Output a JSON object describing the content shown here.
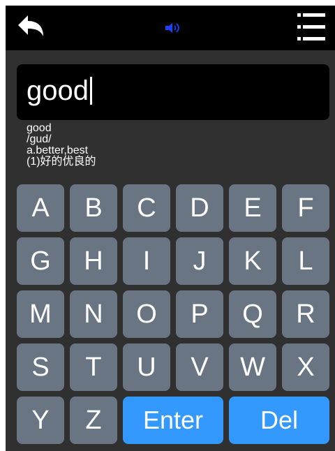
{
  "app": {
    "background": "#303030",
    "topbar_color": "#000000"
  },
  "toolbar": {
    "back_icon": "back-arrow-icon",
    "speaker_icon": "speaker-icon",
    "speaker_color": "#1f3fff",
    "menu_icon": "menu-list-icon"
  },
  "input": {
    "value": "good"
  },
  "definition": {
    "word": "good",
    "phonetic": "/gud/",
    "forms": "a.better,best",
    "meaning": "(1)好的优良的"
  },
  "keyboard": {
    "key_color": "#6a7584",
    "action_color": "#3399ff",
    "rows": [
      [
        "A",
        "B",
        "C",
        "D",
        "E",
        "F"
      ],
      [
        "G",
        "H",
        "I",
        "J",
        "K",
        "L"
      ],
      [
        "M",
        "N",
        "O",
        "P",
        "Q",
        "R"
      ],
      [
        "S",
        "T",
        "U",
        "V",
        "W",
        "X"
      ],
      [
        "Y",
        "Z"
      ]
    ],
    "enter_label": "Enter",
    "delete_label": "Del"
  }
}
